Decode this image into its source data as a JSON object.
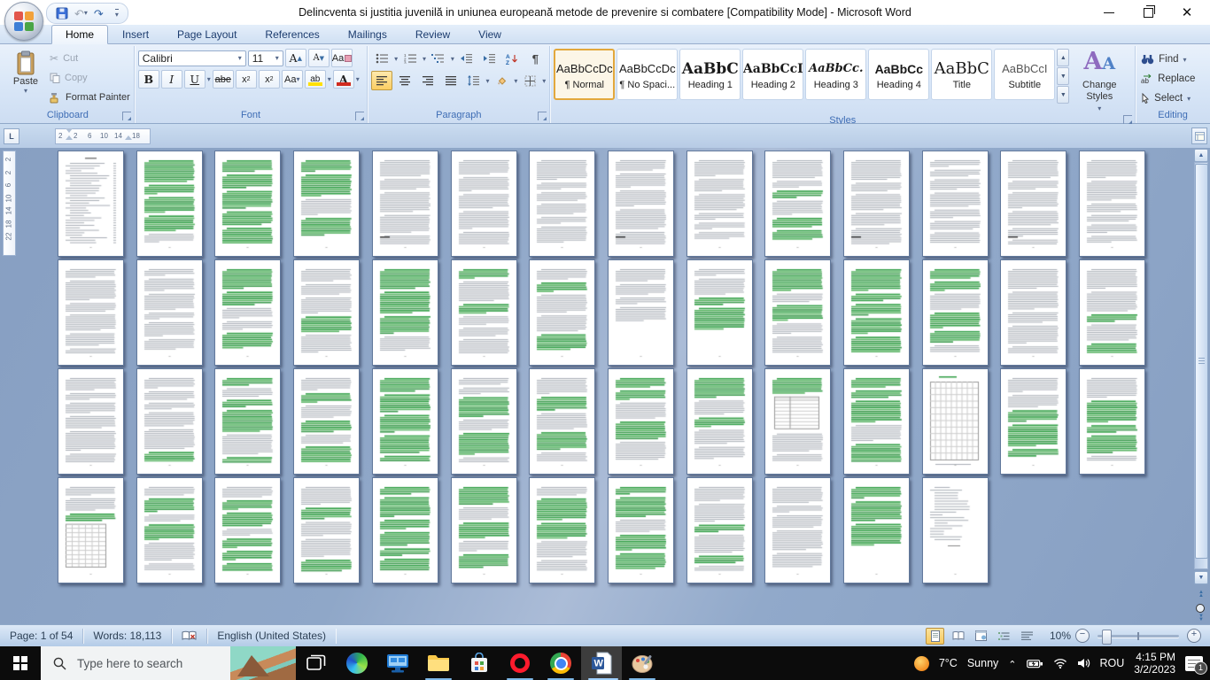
{
  "window": {
    "title": "Delincventa si justitia juvenilă in uniunea europeană metode de prevenire si combatere [Compatibility Mode] - Microsoft Word"
  },
  "quick_access": {
    "items": [
      "save",
      "undo",
      "redo",
      "customize-quick-access"
    ]
  },
  "ribbon": {
    "tabs": [
      {
        "label": "Home",
        "active": true
      },
      {
        "label": "Insert"
      },
      {
        "label": "Page Layout"
      },
      {
        "label": "References"
      },
      {
        "label": "Mailings"
      },
      {
        "label": "Review"
      },
      {
        "label": "View"
      }
    ],
    "clipboard": {
      "label": "Clipboard",
      "paste": "Paste",
      "cut": "Cut",
      "copy": "Copy",
      "format_painter": "Format Painter"
    },
    "font": {
      "label": "Font",
      "name": "Calibri",
      "size": "11"
    },
    "paragraph": {
      "label": "Paragraph"
    },
    "styles": {
      "label": "Styles",
      "change": "Change Styles",
      "items": [
        {
          "preview": "AaBbCcDc",
          "name": "¶ Normal",
          "selected": true
        },
        {
          "preview": "AaBbCcDc",
          "name": "¶ No Spaci..."
        },
        {
          "preview": "AaBbC",
          "name": "Heading 1"
        },
        {
          "preview": "AaBbCcI",
          "name": "Heading 2"
        },
        {
          "preview": "AaBbCc.",
          "name": "Heading 3"
        },
        {
          "preview": "AaBbCc",
          "name": "Heading 4"
        },
        {
          "preview": "AaBbC",
          "name": "Title"
        },
        {
          "preview": "AaBbCcI",
          "name": "Subtitle"
        }
      ]
    },
    "editing": {
      "label": "Editing",
      "find": "Find",
      "replace": "Replace",
      "select": "Select"
    }
  },
  "ruler": {
    "h": [
      "2",
      "2",
      "6",
      "10",
      "14",
      "18"
    ],
    "v": [
      "2",
      "2",
      "6",
      "10",
      "14",
      "18",
      "22"
    ]
  },
  "document": {
    "total_pages": 54,
    "rows": [
      14,
      14,
      14,
      12
    ],
    "pages": [
      "toc",
      "green2",
      "green2",
      "greensparse",
      "text.fn",
      "text",
      "text",
      "text.fn",
      "text",
      "green2",
      "text.fn",
      "text",
      "text.fn",
      "text",
      "text",
      "text",
      "green1",
      "green1",
      "green2",
      "green1",
      "green1",
      "sparse",
      "sparse",
      "green1",
      "green2",
      "green1",
      "text",
      "green1",
      "text",
      "green1",
      "green2",
      "green2",
      "green2",
      "green2",
      "green2",
      "green1",
      "green1",
      "table",
      "green1",
      "grid",
      "green2",
      "green2",
      "tablebottom",
      "green1",
      "green1",
      "green1",
      "green2",
      "green2",
      "green2",
      "green2",
      "green1",
      "text",
      "sparse",
      "endlist"
    ]
  },
  "status": {
    "page": "Page: 1 of 54",
    "words": "Words: 18,113",
    "language": "English (United States)",
    "zoom": "10%",
    "views": [
      "print-layout",
      "full-screen-reading",
      "web-layout",
      "outline",
      "draft"
    ]
  },
  "taskbar": {
    "search": "Type here to search",
    "apps": [
      {
        "name": "task-view"
      },
      {
        "name": "edge"
      },
      {
        "name": "desktop"
      },
      {
        "name": "file-explorer",
        "running": true
      },
      {
        "name": "store"
      },
      {
        "name": "opera",
        "running": true
      },
      {
        "name": "chrome",
        "running": true
      },
      {
        "name": "word",
        "active": true,
        "running": true
      },
      {
        "name": "paint",
        "running": true
      }
    ],
    "tray": {
      "temp": "7°C",
      "condition": "Sunny",
      "lang": "ROU",
      "time": "4:15 PM",
      "date": "3/2/2023",
      "badge": "1"
    }
  }
}
